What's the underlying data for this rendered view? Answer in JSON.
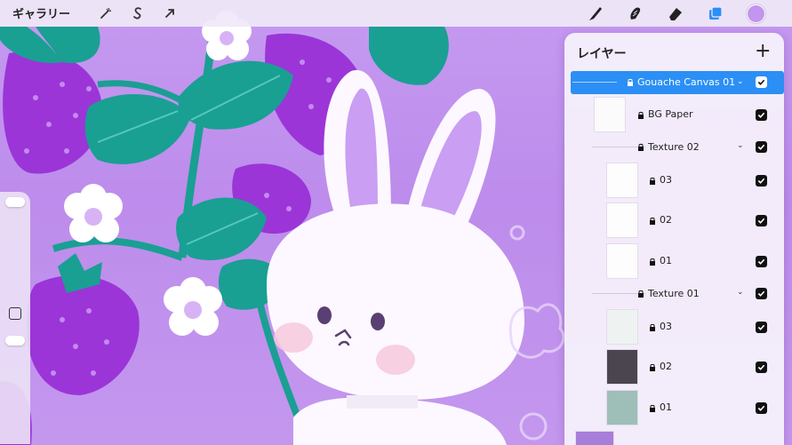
{
  "topbar": {
    "gallery_label": "ギャラリー",
    "left_tools": [
      "magic-wand-icon",
      "selection-s-icon",
      "transform-arrow-icon"
    ],
    "right_tools": [
      "brush-icon",
      "smudge-icon",
      "eraser-icon",
      "layers-icon"
    ],
    "active_tool": "layers-icon",
    "color": "#c295ef"
  },
  "layers_panel": {
    "title": "レイヤー",
    "add_symbol": "+",
    "layers": [
      {
        "name": "Gouache Canvas 01",
        "kind": "group",
        "selected": true,
        "visible": true
      },
      {
        "name": "BG Paper",
        "kind": "layer",
        "visible": true
      },
      {
        "name": "Texture 02",
        "kind": "group",
        "visible": true
      },
      {
        "name": "03",
        "kind": "layer",
        "visible": true
      },
      {
        "name": "02",
        "kind": "layer",
        "visible": true
      },
      {
        "name": "01",
        "kind": "layer",
        "visible": true
      },
      {
        "name": "Texture 01",
        "kind": "group",
        "visible": true
      },
      {
        "name": "03",
        "kind": "layer",
        "visible": true
      },
      {
        "name": "02",
        "kind": "layer",
        "visible": true
      },
      {
        "name": "01",
        "kind": "layer",
        "visible": true
      }
    ]
  },
  "colors": {
    "background": "#bd8cec",
    "strawberry": "#9b35d8",
    "leaf": "#1a9f93",
    "accent_selected": "#2b8ff5"
  }
}
